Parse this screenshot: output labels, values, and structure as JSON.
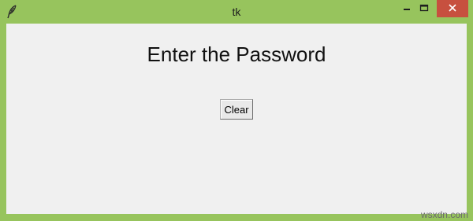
{
  "window": {
    "title": "tk",
    "border_color": "#97c45d",
    "close_color": "#c7503f",
    "app_icon": "feather-icon",
    "controls": [
      "minimize-icon",
      "maximize-icon",
      "close-icon"
    ]
  },
  "main": {
    "heading": "Enter the Password",
    "clear_label": "Clear",
    "background": "#f0f0f0"
  },
  "watermark": "wsxdn.com"
}
